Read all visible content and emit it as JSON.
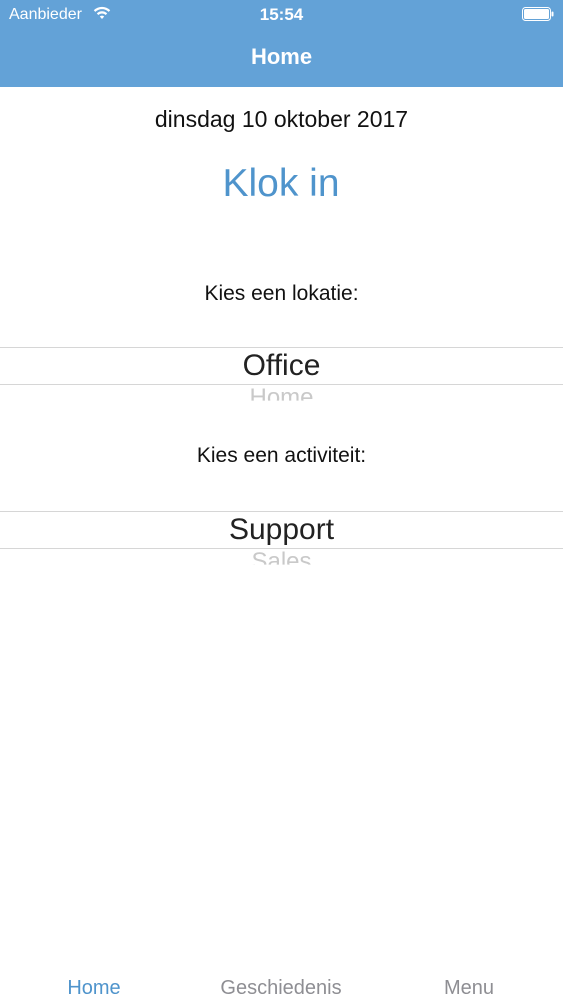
{
  "status_bar": {
    "carrier": "Aanbieder",
    "time": "15:54",
    "wifi_icon": "wifi-icon",
    "battery_icon": "battery-icon"
  },
  "nav": {
    "title": "Home",
    "background_color": "#63a2d7"
  },
  "main": {
    "date": "dinsdag 10 oktober 2017",
    "clock_in_label": "Klok in",
    "location": {
      "label": "Kies een lokatie:",
      "selected": "Office",
      "next": "Home"
    },
    "activity": {
      "label": "Kies een activiteit:",
      "selected": "Support",
      "next": "Sales"
    }
  },
  "tab_bar": {
    "tabs": [
      {
        "label": "Home",
        "active": true
      },
      {
        "label": "Geschiedenis",
        "active": false
      },
      {
        "label": "Menu",
        "active": false
      }
    ],
    "active_color": "#4f94cc",
    "inactive_color": "#8e8e93"
  }
}
